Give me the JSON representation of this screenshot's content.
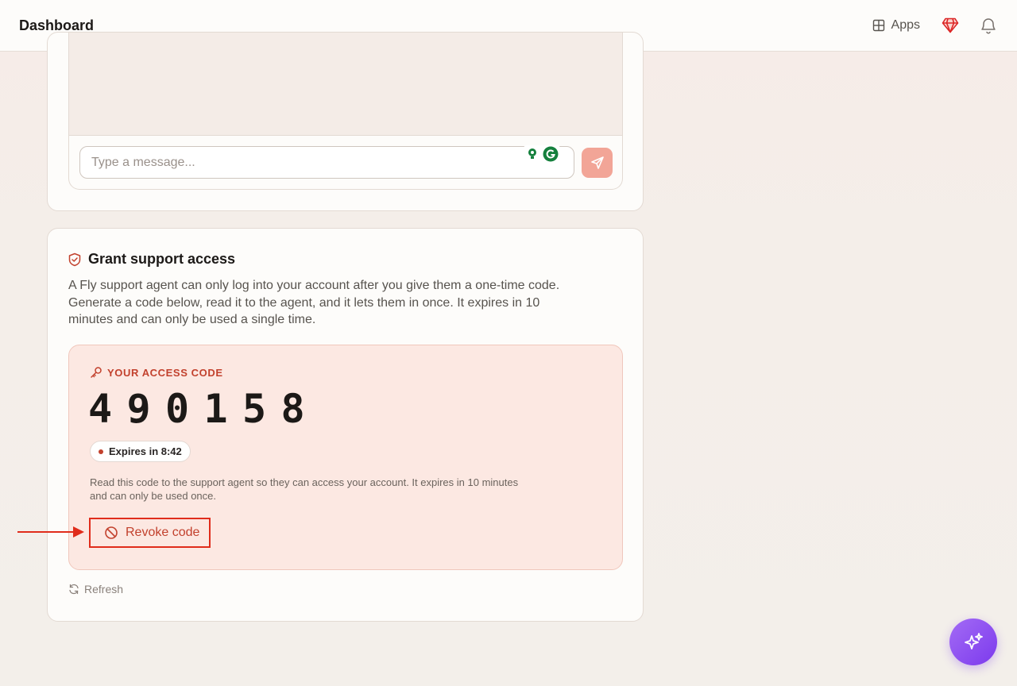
{
  "header": {
    "title": "Dashboard",
    "apps_label": "Apps"
  },
  "chat": {
    "input_placeholder": "Type a message..."
  },
  "grant_access": {
    "title": "Grant support access",
    "description": "A Fly support agent can only log into your account after you give them a one-time code. Generate a code below, read it to the agent, and it lets them in once. It expires in 10 minutes and can only be used a single time.",
    "code_label": "YOUR ACCESS CODE",
    "code_digits": [
      "4",
      "9",
      "0",
      "1",
      "5",
      "8"
    ],
    "expires_label": "Expires in 8:42",
    "code_note": "Read this code to the support agent so they can access your account. It expires in 10 minutes and can only be used once.",
    "revoke_label": "Revoke code",
    "refresh_label": "Refresh"
  },
  "colors": {
    "accent": "#c2412d",
    "highlight": "#e02c1b",
    "send_button": "#f2a597",
    "fab": "#8b5cf6"
  },
  "icons": [
    "apps-grid-icon",
    "gem-icon",
    "bell-icon",
    "send-icon",
    "shield-check-icon",
    "key-icon",
    "ban-icon",
    "refresh-icon",
    "sparkles-icon",
    "grammarly-icon"
  ]
}
